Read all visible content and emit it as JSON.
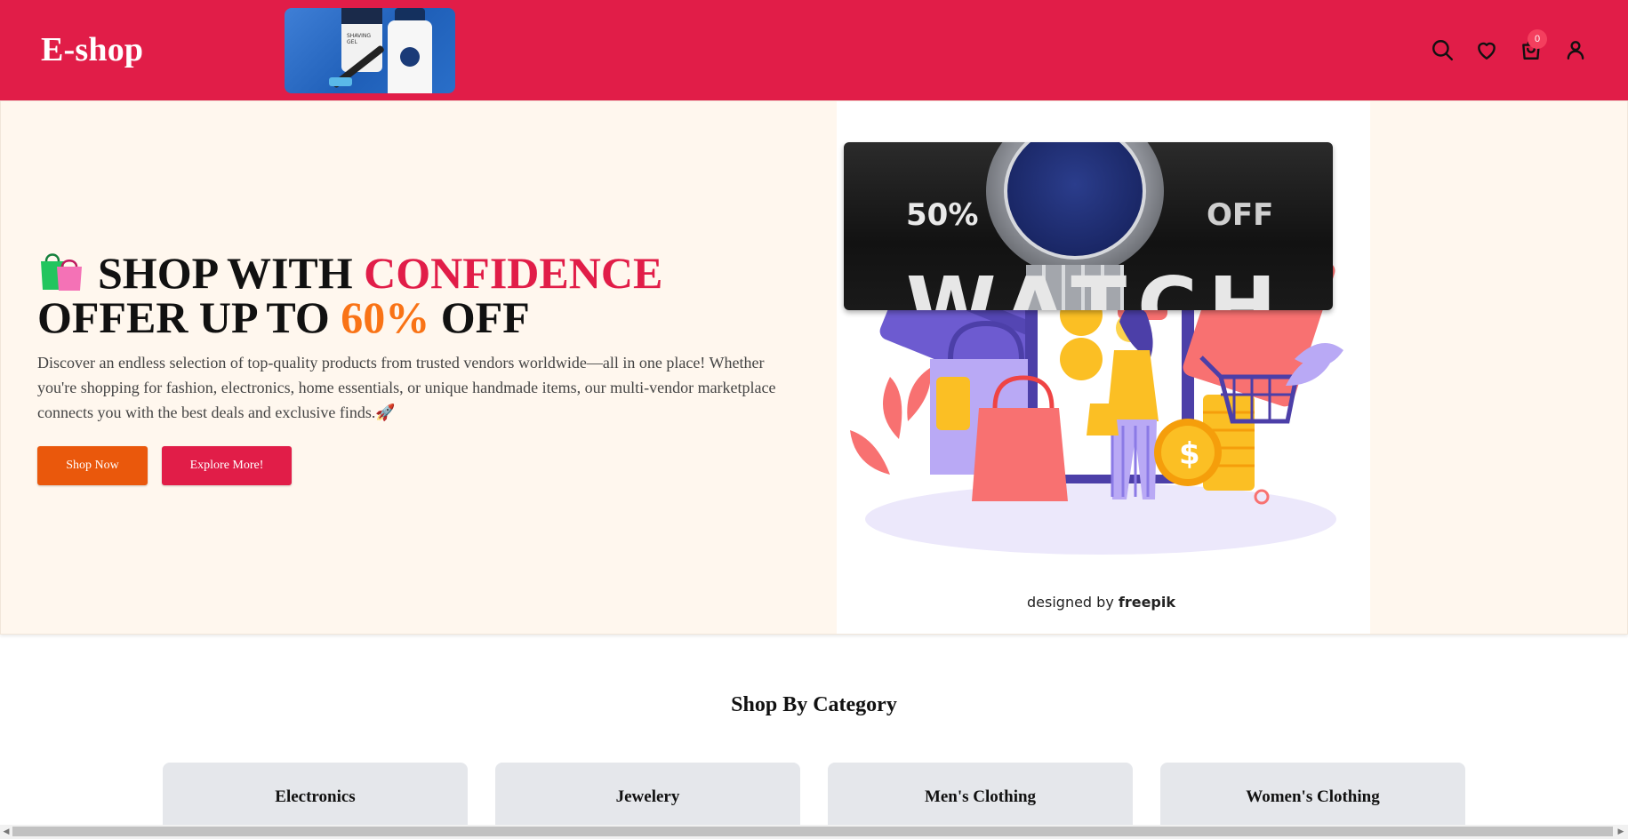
{
  "header": {
    "logo": "E-shop",
    "product_bottle_label": "SHAVING\nGEL",
    "icons": [
      "search-icon",
      "heart-icon",
      "shopping-bag-icon",
      "user-icon"
    ],
    "cart_count": "0"
  },
  "hero": {
    "title_prefix": "SHOP WITH ",
    "title_accent": "CONFIDENCE",
    "line2_prefix": "OFFER UP TO ",
    "line2_accent": "60%",
    "line2_suffix": " OFF",
    "description": "Discover an endless selection of top-quality products from trusted vendors worldwide—all in one place! Whether you're shopping for fashion, electronics, home essentials, or unique handmade items, our multi-vendor marketplace connects you with the best deals and exclusive finds.🚀",
    "shop_now": "Shop Now",
    "explore_more": "Explore More!",
    "banner_left": "50%",
    "banner_right": "OFF",
    "banner_word": "WATCH",
    "credit_prefix": "designed by ",
    "credit_brand": "freepik"
  },
  "categories": {
    "title": "Shop By Category",
    "items": [
      "Electronics",
      "Jewelery",
      "Men's Clothing",
      "Women's Clothing"
    ]
  },
  "colors": {
    "brand": "#e11d48",
    "orange": "#ea580c",
    "hero_bg": "#fff7ee",
    "card_bg": "#e5e7eb"
  }
}
